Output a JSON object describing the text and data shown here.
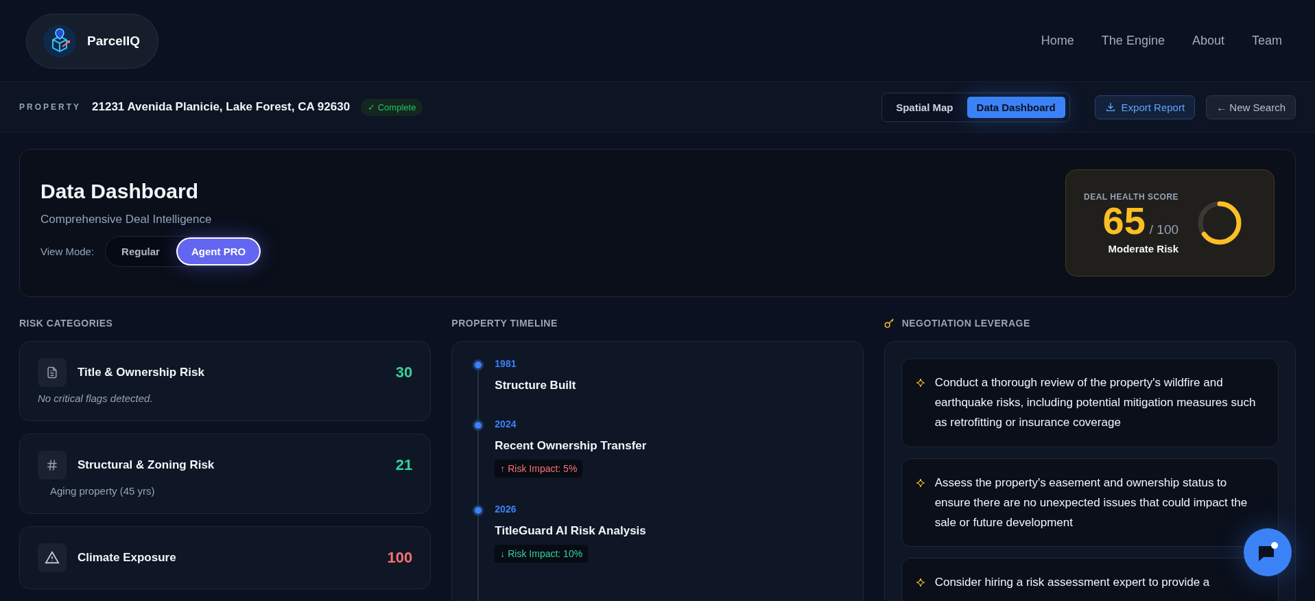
{
  "brand": {
    "name": "ParcelIQ"
  },
  "nav": [
    {
      "label": "Home"
    },
    {
      "label": "The Engine"
    },
    {
      "label": "About"
    },
    {
      "label": "Team"
    }
  ],
  "property_bar": {
    "label": "PROPERTY",
    "address": "21231 Avenida Planicie, Lake Forest, CA 92630",
    "status": "✓ Complete",
    "views": [
      {
        "label": "Spatial Map",
        "selected": false
      },
      {
        "label": "Data Dashboard",
        "selected": true
      }
    ],
    "export_button": "Export Report",
    "new_search_button": "← New Search"
  },
  "dashboard": {
    "title": "Data Dashboard",
    "subtitle": "Comprehensive Deal Intelligence",
    "view_mode_label": "View Mode:",
    "modes": [
      {
        "label": "Regular",
        "selected": false
      },
      {
        "label": "Agent PRO",
        "selected": true
      }
    ],
    "score": {
      "label": "DEAL HEALTH SCORE",
      "value": "65",
      "max": "/ 100",
      "rating": "Moderate Risk",
      "level": 0.65
    }
  },
  "risk_categories": {
    "heading": "RISK CATEGORIES",
    "items": [
      {
        "kind": "document",
        "title": "Title & Ownership Risk",
        "score": "30",
        "color": "#34d399",
        "note": {
          "text": "No critical flags detected.",
          "kind": "italic"
        }
      },
      {
        "kind": "hash",
        "title": "Structural & Zoning Risk",
        "score": "21",
        "color": "#34d399",
        "note": {
          "text": "Aging property (45 yrs)",
          "kind": "plain"
        }
      },
      {
        "kind": "warning",
        "title": "Climate Exposure",
        "score": "100",
        "color": "#f87171"
      }
    ]
  },
  "timeline": {
    "heading": "PROPERTY TIMELINE",
    "events": [
      {
        "year": "1981",
        "title": "Structure Built"
      },
      {
        "year": "2024",
        "title": "Recent Ownership Transfer",
        "impact": {
          "kind": "increase",
          "text": "↑ Risk Impact: 5%"
        }
      },
      {
        "year": "2026",
        "title": "TitleGuard AI Risk Analysis",
        "impact": {
          "kind": "decrease",
          "text": "↓ Risk Impact: 10%"
        }
      }
    ]
  },
  "leverage": {
    "heading": "NEGOTIATION LEVERAGE",
    "items": [
      "Conduct a thorough review of the property's wildfire and earthquake risks, including potential mitigation measures such as retrofitting or insurance coverage",
      "Assess the property's easement and ownership status to ensure there are no unexpected issues that could impact the sale or future development",
      "Consider hiring a risk assessment expert to provide a"
    ]
  }
}
